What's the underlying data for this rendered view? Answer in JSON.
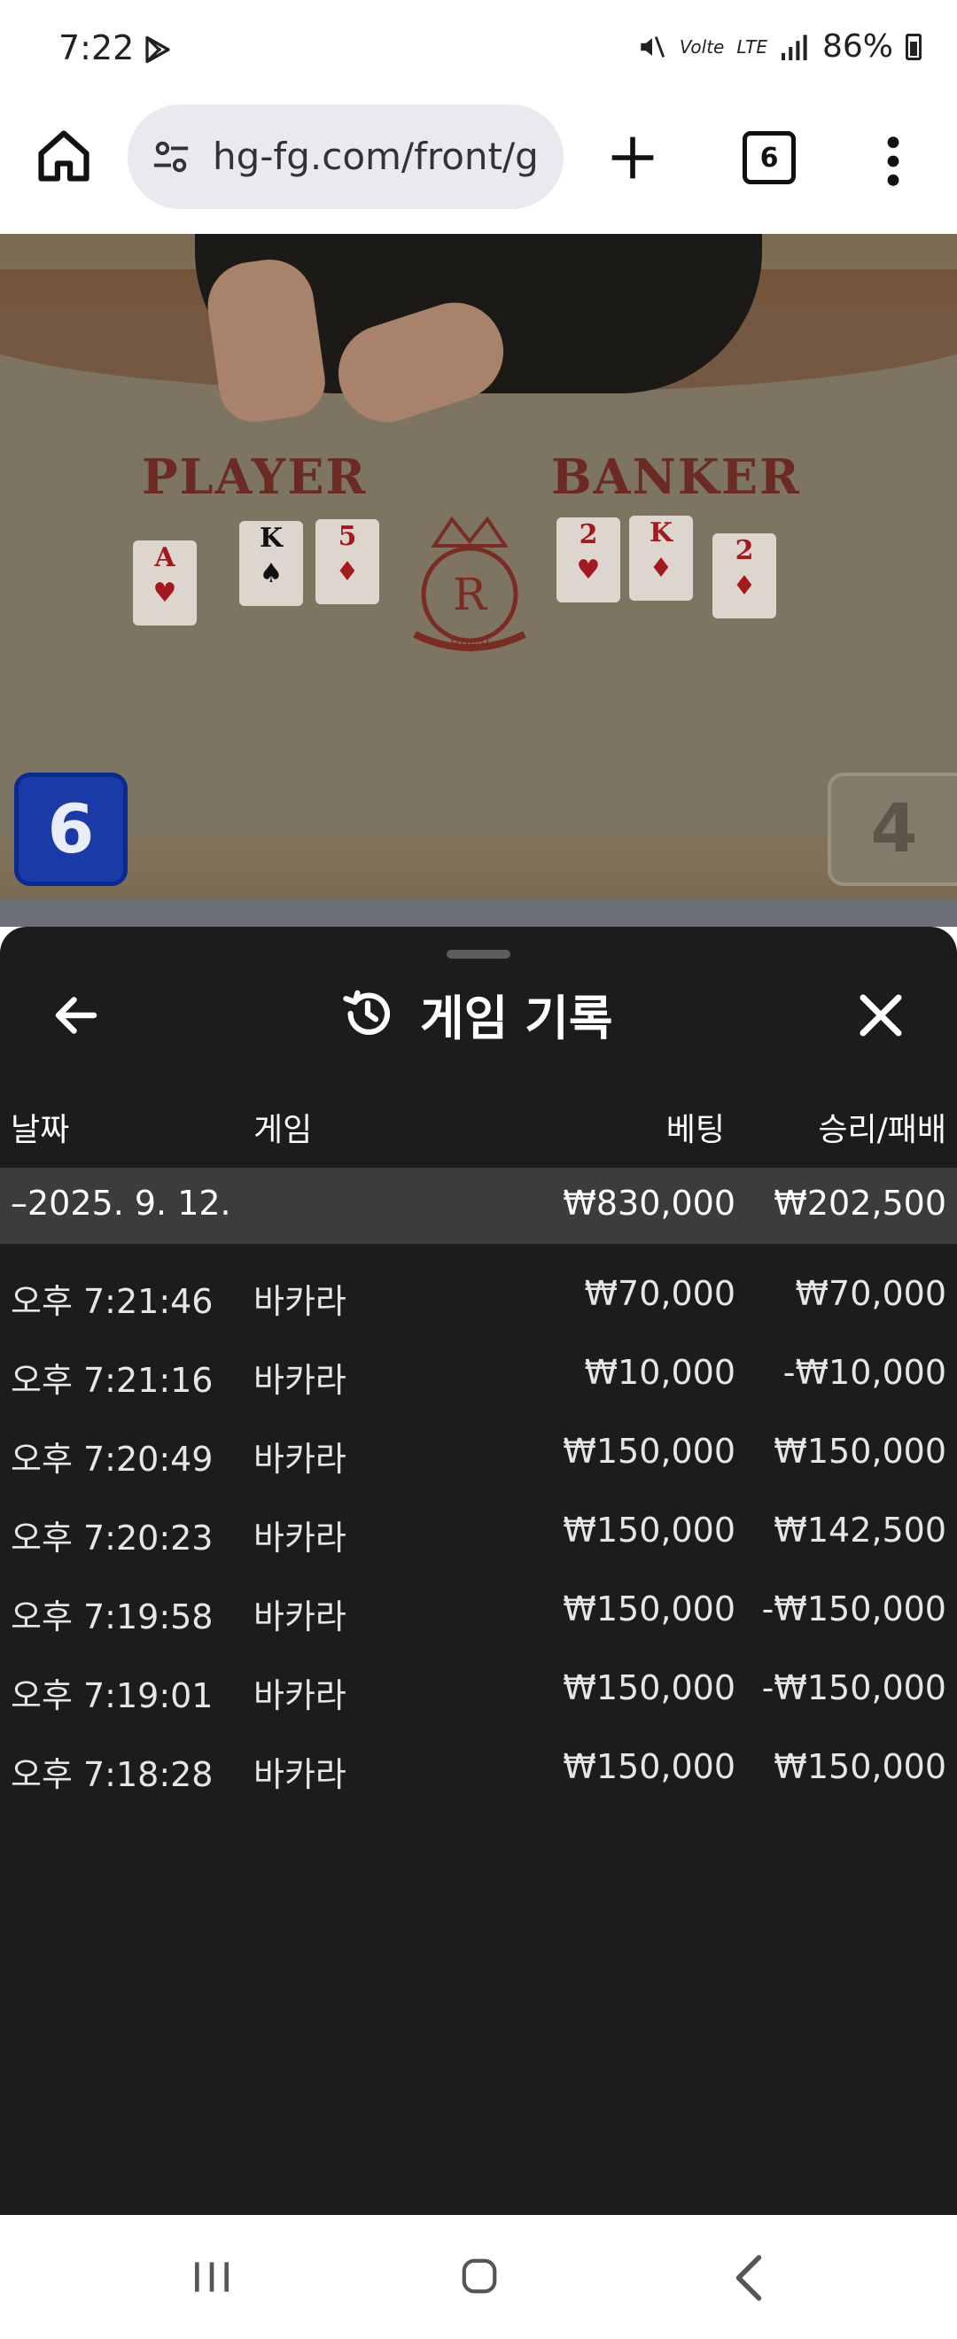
{
  "status": {
    "time": "7:22",
    "volte": "Volte",
    "network": "LTE",
    "battery": "86%"
  },
  "browser": {
    "url": "hg-fg.com/front/g",
    "tab_count": "6"
  },
  "video": {
    "player_label": "PLAYER",
    "banker_label": "BANKER",
    "crest_letter": "R",
    "crest_text": "Royal",
    "player_cards": [
      {
        "rank": "A",
        "suit": "♥"
      },
      {
        "rank": "K",
        "suit": "♠"
      },
      {
        "rank": "5",
        "suit": "♦"
      }
    ],
    "banker_cards": [
      {
        "rank": "2",
        "suit": "♥"
      },
      {
        "rank": "K",
        "suit": "♦"
      },
      {
        "rank": "2",
        "suit": "♦"
      }
    ],
    "player_score": "6",
    "banker_score": "4"
  },
  "sheet": {
    "title": "게임 기록",
    "columns": {
      "date": "날짜",
      "game": "게임",
      "bet": "베팅",
      "result": "승리/패배"
    },
    "summary": {
      "date": "–2025. 9. 12.",
      "bet": "₩830,000",
      "result": "₩202,500"
    },
    "rows": [
      {
        "time": "오후 7:21:46",
        "game": "바카라",
        "bet": "₩70,000",
        "result": "₩70,000"
      },
      {
        "time": "오후 7:21:16",
        "game": "바카라",
        "bet": "₩10,000",
        "result": "-₩10,000"
      },
      {
        "time": "오후 7:20:49",
        "game": "바카라",
        "bet": "₩150,000",
        "result": "₩150,000"
      },
      {
        "time": "오후 7:20:23",
        "game": "바카라",
        "bet": "₩150,000",
        "result": "₩142,500"
      },
      {
        "time": "오후 7:19:58",
        "game": "바카라",
        "bet": "₩150,000",
        "result": "-₩150,000"
      },
      {
        "time": "오후 7:19:01",
        "game": "바카라",
        "bet": "₩150,000",
        "result": "-₩150,000"
      },
      {
        "time": "오후 7:18:28",
        "game": "바카라",
        "bet": "₩150,000",
        "result": "₩150,000"
      }
    ]
  },
  "colors": {
    "sheet_bg": "#1c1c1c",
    "summary_bg": "#3c3c3c",
    "player_blue": "#1a3aa8"
  }
}
